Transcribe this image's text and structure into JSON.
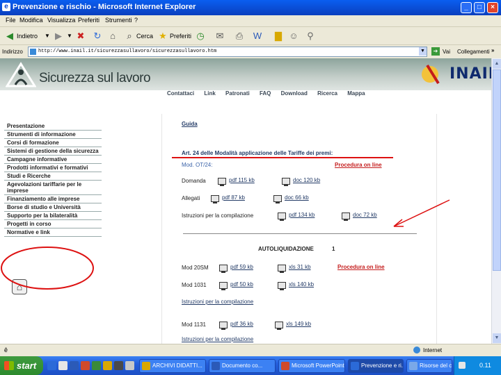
{
  "window": {
    "title": "Prevenzione e rischio - Microsoft Internet Explorer",
    "controls": [
      "_",
      "□",
      "×"
    ]
  },
  "menu": [
    "File",
    "Modifica",
    "Visualizza",
    "Preferiti",
    "Strumenti",
    "?"
  ],
  "toolbar": {
    "back_label": "Indietro",
    "search_label": "Cerca",
    "favorites_label": "Preferiti"
  },
  "address": {
    "label": "Indirizzo",
    "url": "http://www.inail.it/sicurezzasullavoro/sicurezzasullavoro.htm",
    "go_label": "Vai",
    "links_label": "Collegamenti",
    "chevron": "»"
  },
  "site": {
    "title": "Sicurezza sul lavoro",
    "brand": "INAIL",
    "topnav": [
      "Contattaci",
      "Link",
      "Patronati",
      "FAQ",
      "Download",
      "Ricerca",
      "Mappa"
    ]
  },
  "sidebar": {
    "items": [
      "Presentazione",
      "Strumenti di informazione",
      "Corsi di formazione",
      "Sistemi di gestione della sicurezza",
      "Campagne informative",
      "Prodotti informativi e formativi",
      "Studi e Ricerche",
      "Agevolazioni tariffarie per le imprese",
      "Finanziamento alle imprese",
      "Borse di studio e Università",
      "Supporto per la bilateralità",
      "Progetti in corso",
      "Normative e link"
    ]
  },
  "content": {
    "guide_title": "Guida",
    "art_title": "Art. 24 delle Modalità applicazione delle Tariffe dei premi:",
    "mod_ot24": "Mod. OT/24:",
    "procedura": "Procedura on line",
    "rows_ot24": [
      {
        "label": "Domanda",
        "pdf": "pdf 115 kb",
        "doc": "doc 120 kb"
      },
      {
        "label": "Allegati",
        "pdf": "pdf 87 kb",
        "doc": "doc 66 kb"
      },
      {
        "label": "Istruzioni per la compilazione",
        "pdf": "pdf 134 kb",
        "doc": "doc 72 kb"
      }
    ],
    "autoliq_title": "AUTOLIQUIDAZIONE",
    "autoliq_num": "1",
    "rows_autoliq": [
      {
        "label": "Mod 20SM",
        "pdf": "pdf 59 kb",
        "xls": "xls 31 kb",
        "extra": "Procedura on line"
      },
      {
        "label": "Mod 1031",
        "pdf": "pdf 50 kb",
        "xls": "xls 140 kb"
      }
    ],
    "istr1": "Istruzioni per la compilazione",
    "row_1131": {
      "label": "Mod 1131",
      "pdf": "pdf 36 kb",
      "xls": "xls 149 kb"
    },
    "istr2": "Istruzioni per la compilazione"
  },
  "status": {
    "left": "ê",
    "zone": "Internet"
  },
  "taskbar": {
    "start": "start",
    "tasks": [
      "ARCHIVI DIDATTI...",
      "Documento co...",
      "Microsoft PowerPoint...",
      "Prevenzione e ri...",
      "Risorse del computer"
    ],
    "clock": "0.11"
  },
  "colors": {
    "accent_red": "#c41c1c",
    "link": "#223a66",
    "header": "#8da49c"
  }
}
